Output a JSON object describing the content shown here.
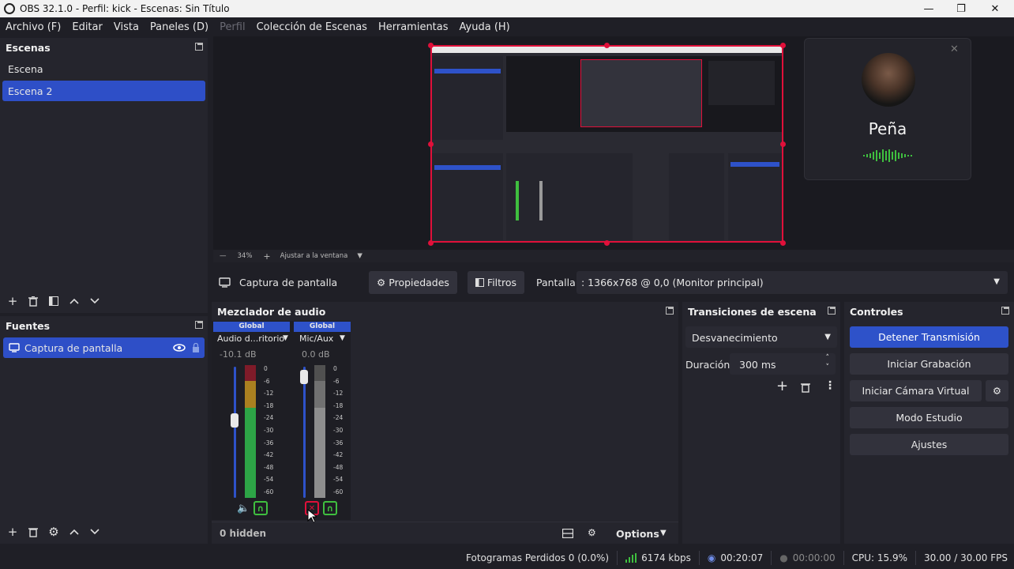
{
  "window": {
    "title": "OBS 32.1.0 - Perfil: kick - Escenas: Sin Título",
    "minimize": "—",
    "maximize": "❐",
    "close": "✕"
  },
  "menu": [
    "Archivo (F)",
    "Editar",
    "Vista",
    "Paneles (D)",
    "Perfil",
    "Colección de Escenas",
    "Herramientas",
    "Ayuda (H)"
  ],
  "scenes": {
    "title": "Escenas",
    "items": [
      "Escena",
      "Escena 2"
    ],
    "selected": 1
  },
  "sources": {
    "title": "Fuentes",
    "items": [
      "Captura de pantalla"
    ]
  },
  "preview_bar": {
    "zoom": "34%",
    "fit": "Ajustar a la ventana"
  },
  "call_overlay": {
    "name": "Peña"
  },
  "source_toolbar": {
    "source": "Captura de pantalla",
    "properties": "Propiedades",
    "filters": "Filtros",
    "display_label": "Pantalla",
    "display_value": ": 1366x768 @ 0,0 (Monitor principal)"
  },
  "mixer": {
    "title": "Mezclador de audio",
    "channels": [
      {
        "badge": "Global",
        "name": "Audio d...ritorio",
        "db": "-10.1 dB",
        "level": 0.62,
        "muted": false
      },
      {
        "badge": "Global",
        "name": "Mic/Aux",
        "db": "0.0 dB",
        "level": 0.99,
        "muted": true
      }
    ],
    "scale": [
      "0",
      "-6",
      "-12",
      "-18",
      "-24",
      "-30",
      "-36",
      "-42",
      "-48",
      "-54",
      "-60"
    ],
    "hidden": "0 hidden",
    "options": "Options"
  },
  "transitions": {
    "title": "Transiciones de escena",
    "type": "Desvanecimiento",
    "duration_label": "Duración",
    "duration_value": "300 ms"
  },
  "controls": {
    "title": "Controles",
    "buttons": [
      "Detener Transmisión",
      "Iniciar Grabación",
      "Iniciar Cámara Virtual",
      "Modo Estudio",
      "Ajustes"
    ]
  },
  "status": {
    "dropped": "Fotogramas Perdidos 0 (0.0%)",
    "kbps": "6174 kbps",
    "stream_time": "00:20:07",
    "rec_time": "00:00:00",
    "cpu": "CPU: 15.9%",
    "fps": "30.00 / 30.00 FPS"
  },
  "colors": {
    "accent": "#2e52c9",
    "live": "#3fbf3f",
    "danger": "#e0103a"
  }
}
